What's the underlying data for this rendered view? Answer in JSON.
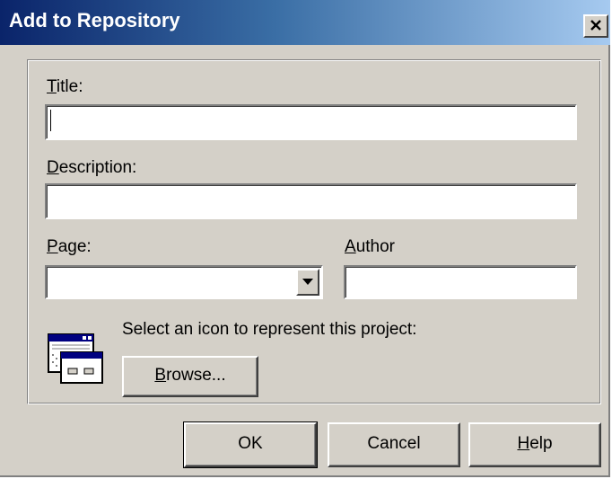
{
  "window": {
    "title": "Add to Repository",
    "close_glyph": "✕"
  },
  "form": {
    "title_label_ul": "T",
    "title_label_rest": "itle:",
    "title_value": "",
    "description_label_ul": "D",
    "description_label_rest": "escription:",
    "description_value": "",
    "page_label_ul": "P",
    "page_label_rest": "age:",
    "page_value": "",
    "author_label_ul": "A",
    "author_label_rest": "uthor",
    "author_value": ""
  },
  "icon_section": {
    "prompt": "Select an icon to represent this project:",
    "browse_ul": "B",
    "browse_rest": "rowse...",
    "icon_name": "project-window-icon"
  },
  "buttons": {
    "ok": "OK",
    "cancel": "Cancel",
    "help_ul": "H",
    "help_rest": "elp"
  }
}
